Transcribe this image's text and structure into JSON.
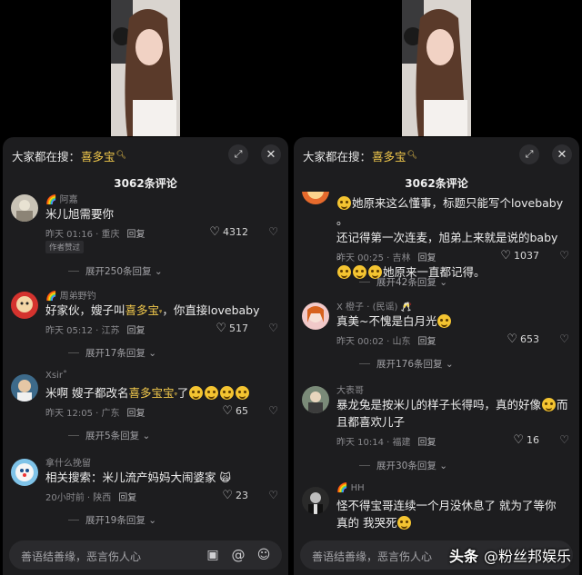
{
  "header": {
    "search_prefix": "大家都在搜：",
    "search_keyword": "喜多宝"
  },
  "comments_count": "3062条评论",
  "input": {
    "placeholder": "善语结善缘，恶言伤人心"
  },
  "watermark": {
    "brand": "头条",
    "account": "@粉丝邦娱乐"
  },
  "icons": {
    "search_hint": "search-icon",
    "expand": "expand-icon",
    "close": "close-icon",
    "like": "heart-icon",
    "dislike": "broken-heart-icon",
    "image": "image-icon",
    "mention": "at-icon",
    "emoji": "emoji-icon"
  },
  "colors": {
    "accent": "#f2c94c",
    "sheet_bg": "#1d1d1f",
    "text": "#ededed",
    "muted": "#8a8a8e"
  },
  "left_comments": [
    {
      "user": "阿嘉",
      "text": "米儿旭需要你",
      "time": "昨天 01:16 · 重庆",
      "reply": "回复",
      "likes": "4312",
      "badge": "作者赞过",
      "replies": "展开250条回复"
    },
    {
      "user": "周弟野钓",
      "text_before": "好家伙，嫂子叫",
      "keyword": "喜多宝",
      "text_after": "，你直接lovebaby",
      "time": "昨天 05:12 · 江苏",
      "reply": "回复",
      "likes": "517",
      "replies": "展开17条回复"
    },
    {
      "user": "Xsir",
      "text_before": "米啊  嫂子都改名",
      "keyword": "喜多宝宝",
      "text_after": "了",
      "time": "昨天 12:05 · 广东",
      "reply": "回复",
      "likes": "65",
      "replies": "展开5条回复"
    },
    {
      "user": "拿什么挽留",
      "text": "相关搜索：米儿流产妈妈大闹婆家",
      "time": "20小时前 · 陕西",
      "reply": "回复",
      "likes": "23",
      "replies": "展开19条回复"
    }
  ],
  "right_comments": [
    {
      "line1": "她原来这么懂事，标题只能写个lovebaby 。",
      "line2": "还记得第一次连麦，旭弟上来就是说的baby 。",
      "line3": "她原来一直都记得。",
      "time": "昨天 00:25 · 吉林",
      "reply": "回复",
      "likes": "1037",
      "replies": "展开42条回复"
    },
    {
      "user": "X 橙子 · (民谣)",
      "text": "真美~不愧是白月光",
      "time": "昨天 00:02 · 山东",
      "reply": "回复",
      "likes": "653",
      "replies": "展开176条回复"
    },
    {
      "user": "大表哥",
      "line1": "暴龙兔是按米儿的样子长得吗，真的好像",
      "line1_end": "而",
      "line2": "且都喜欢儿子",
      "time": "昨天 10:14 · 福建",
      "reply": "回复",
      "likes": "16",
      "replies": "展开30条回复"
    },
    {
      "user": "HH",
      "line1": "怪不得宝哥连续一个月没休息了  就为了等你",
      "line2": "真的  我哭死"
    }
  ]
}
